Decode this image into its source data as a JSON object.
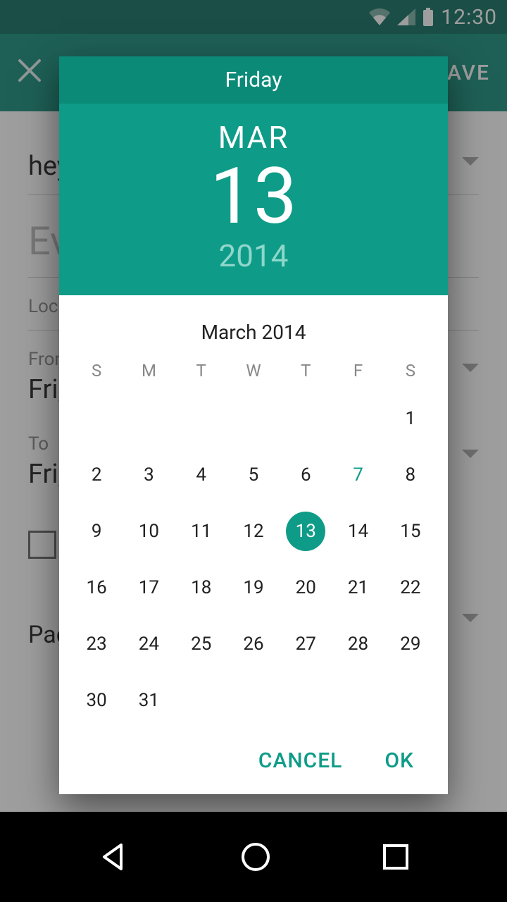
{
  "status": {
    "time": "12:30"
  },
  "appbar": {
    "save": "SAVE"
  },
  "form": {
    "account": "hey",
    "event_placeholder": "Ev",
    "location_label": "Loc",
    "from_label": "From",
    "from_value": "Fri,",
    "to_label": "To",
    "to_value": "Fri,",
    "pac": "Pac"
  },
  "picker": {
    "weekday": "Friday",
    "month_abbr": "MAR",
    "day": "13",
    "year": "2014",
    "month_title": "March 2014",
    "dow": [
      "S",
      "M",
      "T",
      "W",
      "T",
      "F",
      "S"
    ],
    "weeks": [
      [
        "",
        "",
        "",
        "",
        "",
        "",
        "1"
      ],
      [
        "2",
        "3",
        "4",
        "5",
        "6",
        "7",
        "8"
      ],
      [
        "9",
        "10",
        "11",
        "12",
        "13",
        "14",
        "15"
      ],
      [
        "16",
        "17",
        "18",
        "19",
        "20",
        "21",
        "22"
      ],
      [
        "23",
        "24",
        "25",
        "26",
        "27",
        "28",
        "29"
      ],
      [
        "30",
        "31",
        "",
        "",
        "",
        "",
        ""
      ]
    ],
    "selected_day": "13",
    "highlight_day": "7",
    "cancel": "CANCEL",
    "ok": "OK"
  }
}
